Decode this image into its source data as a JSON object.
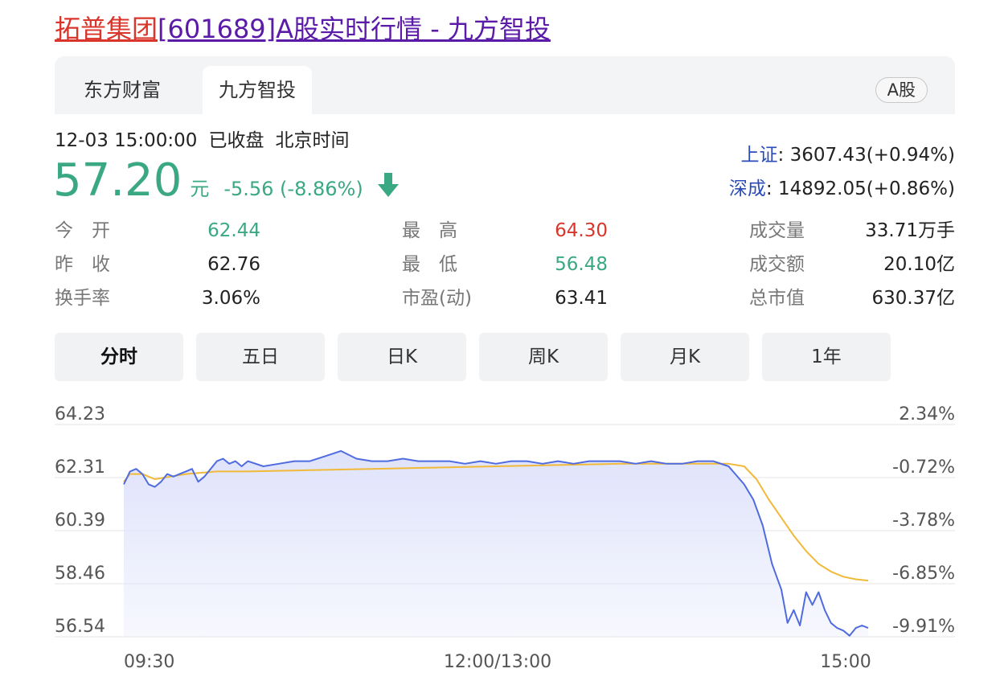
{
  "page_title": {
    "name_part": "拓普集团",
    "rest_part": "[601689]A股实时行情 - 九方智投"
  },
  "tabs": [
    {
      "label": "东方财富"
    },
    {
      "label": "九方智投"
    }
  ],
  "market_badge": "A股",
  "status": {
    "datetime": "12-03 15:00:00",
    "state": "已收盘",
    "timezone": "北京时间"
  },
  "price": {
    "current": "57.20",
    "unit": "元",
    "change": "-5.56 (-8.86%)",
    "direction_icon": "down-arrow-icon",
    "color": "#3aa882"
  },
  "indices": [
    {
      "label": "上证",
      "value": ": 3607.43(+0.94%)"
    },
    {
      "label": "深成",
      "value": ": 14892.05(+0.86%)"
    }
  ],
  "quotes": {
    "col1": [
      {
        "label": "今　开",
        "value": "62.44",
        "tone": "green"
      },
      {
        "label": "昨　收",
        "value": "62.76",
        "tone": ""
      },
      {
        "label": "换手率",
        "value": "3.06%",
        "tone": ""
      }
    ],
    "col2": [
      {
        "label": "最　高",
        "value": "64.30",
        "tone": "red"
      },
      {
        "label": "最　低",
        "value": "56.48",
        "tone": "green"
      },
      {
        "label": "市盈(动)",
        "value": "63.41",
        "tone": ""
      }
    ],
    "col3": [
      {
        "label": "成交量",
        "value": "33.71万手"
      },
      {
        "label": "成交额",
        "value": "20.10亿"
      },
      {
        "label": "总市值",
        "value": "630.37亿"
      }
    ]
  },
  "period_tabs": [
    {
      "label": "分时",
      "active": true
    },
    {
      "label": "五日",
      "active": false
    },
    {
      "label": "日K",
      "active": false
    },
    {
      "label": "周K",
      "active": false
    },
    {
      "label": "月K",
      "active": false
    },
    {
      "label": "1年",
      "active": false
    }
  ],
  "colors": {
    "up": "#d9352b",
    "down": "#3aa882",
    "price_line": "#4f6be0",
    "avg_line": "#f0b93a",
    "area_fill": "#dfe3fb"
  },
  "chart_data": {
    "type": "line",
    "y_left_ticks": [
      "64.23",
      "62.31",
      "60.39",
      "58.46",
      "56.54"
    ],
    "y_right_ticks": [
      "2.34%",
      "-0.72%",
      "-3.78%",
      "-6.85%",
      "-9.91%"
    ],
    "x_ticks": [
      "09:30",
      "12:00/13:00",
      "15:00"
    ],
    "ylim": [
      55.96,
      64.23
    ],
    "x_range_minutes": [
      0,
      240
    ],
    "grid": true,
    "series": [
      {
        "key": "price",
        "x": [
          0,
          2,
          4,
          6,
          8,
          10,
          12,
          14,
          16,
          18,
          20,
          22,
          24,
          26,
          28,
          30,
          32,
          34,
          36,
          38,
          40,
          45,
          50,
          55,
          60,
          65,
          70,
          75,
          80,
          85,
          90,
          95,
          100,
          105,
          110,
          115,
          120,
          125,
          130,
          135,
          140,
          145,
          150,
          155,
          160,
          165,
          170,
          175,
          180,
          185,
          190,
          195,
          200,
          203,
          206,
          209,
          212,
          214,
          216,
          218,
          220,
          222,
          224,
          226,
          228,
          230,
          232,
          234,
          236,
          238,
          240
        ],
        "y": [
          61.9,
          62.4,
          62.5,
          62.3,
          61.9,
          61.8,
          62.0,
          62.3,
          62.2,
          62.3,
          62.4,
          62.5,
          62.0,
          62.2,
          62.5,
          62.8,
          62.9,
          62.7,
          62.8,
          62.6,
          62.8,
          62.6,
          62.7,
          62.8,
          62.8,
          63.0,
          63.2,
          62.9,
          62.8,
          62.8,
          62.9,
          62.8,
          62.8,
          62.8,
          62.7,
          62.8,
          62.7,
          62.8,
          62.8,
          62.7,
          62.8,
          62.7,
          62.8,
          62.8,
          62.8,
          62.7,
          62.8,
          62.7,
          62.7,
          62.8,
          62.8,
          62.6,
          61.9,
          61.3,
          60.3,
          58.8,
          57.8,
          56.5,
          57.0,
          56.4,
          57.7,
          57.2,
          57.7,
          57.0,
          56.5,
          56.3,
          56.2,
          56.0,
          56.3,
          56.4,
          56.3
        ]
      },
      {
        "key": "avg",
        "x": [
          0,
          2,
          4,
          6,
          8,
          10,
          15,
          20,
          30,
          40,
          60,
          80,
          100,
          120,
          140,
          160,
          180,
          195,
          200,
          204,
          208,
          212,
          216,
          220,
          224,
          228,
          232,
          236,
          240
        ],
        "y": [
          62.0,
          62.3,
          62.3,
          62.3,
          62.2,
          62.1,
          62.2,
          62.3,
          62.4,
          62.4,
          62.45,
          62.5,
          62.55,
          62.6,
          62.65,
          62.7,
          62.7,
          62.7,
          62.6,
          62.1,
          61.3,
          60.6,
          59.9,
          59.3,
          58.8,
          58.5,
          58.3,
          58.2,
          58.15
        ]
      }
    ]
  }
}
